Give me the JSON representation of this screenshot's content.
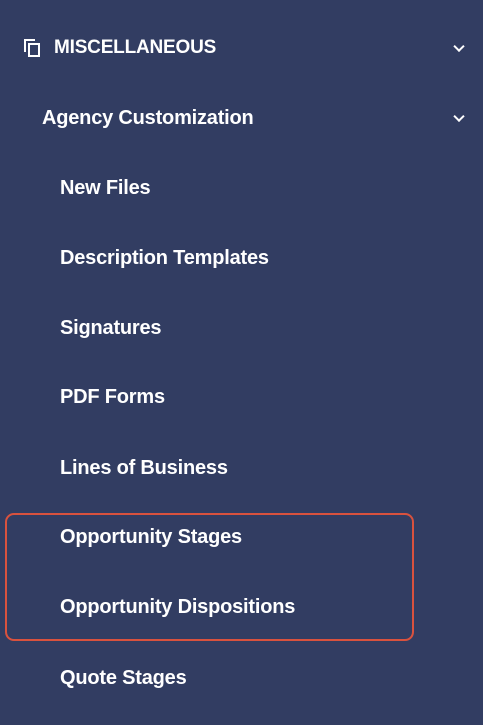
{
  "section": {
    "label": "MISCELLANEOUS",
    "icon": "copy-icon",
    "expanded_icon": "chevron-down-icon"
  },
  "subsection": {
    "label": "Agency Customization",
    "expanded_icon": "chevron-down-icon"
  },
  "items": [
    {
      "label": "New Files"
    },
    {
      "label": "Description Templates"
    },
    {
      "label": "Signatures"
    },
    {
      "label": "PDF Forms"
    },
    {
      "label": "Lines of Business"
    },
    {
      "label": "Opportunity Stages"
    },
    {
      "label": "Opportunity Dispositions"
    },
    {
      "label": "Quote Stages"
    }
  ],
  "colors": {
    "background": "#323d62",
    "text": "#ffffff",
    "highlight_border": "#d9523e"
  }
}
